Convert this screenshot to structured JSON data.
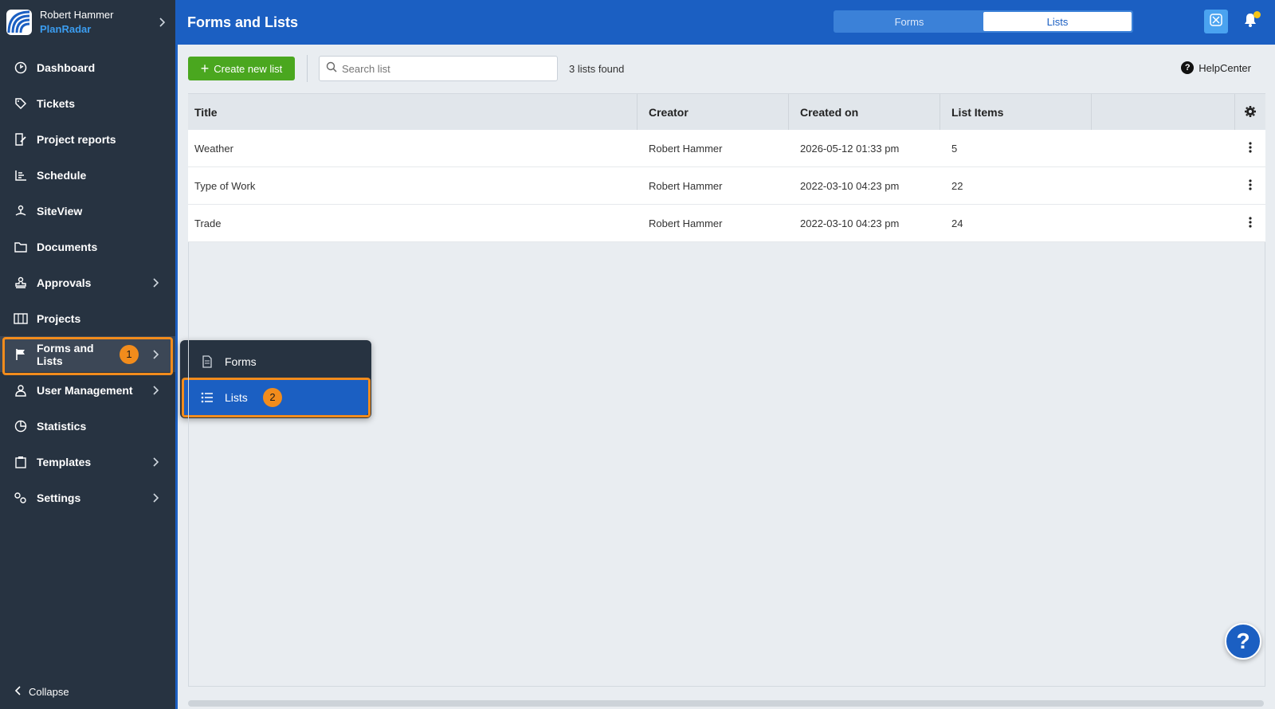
{
  "user": {
    "name": "Robert Hammer",
    "brand": "PlanRadar"
  },
  "sidebar": {
    "items": [
      {
        "label": "Dashboard",
        "icon": "dashboard-icon",
        "has_chevron": false
      },
      {
        "label": "Tickets",
        "icon": "tag-icon",
        "has_chevron": false
      },
      {
        "label": "Project reports",
        "icon": "report-icon",
        "has_chevron": false
      },
      {
        "label": "Schedule",
        "icon": "schedule-icon",
        "has_chevron": false
      },
      {
        "label": "SiteView",
        "icon": "siteview-icon",
        "has_chevron": false
      },
      {
        "label": "Documents",
        "icon": "folder-icon",
        "has_chevron": false
      },
      {
        "label": "Approvals",
        "icon": "stamp-icon",
        "has_chevron": true
      },
      {
        "label": "Projects",
        "icon": "projects-icon",
        "has_chevron": false
      },
      {
        "label": "Forms and Lists",
        "icon": "flag-icon",
        "has_chevron": true,
        "badge": "1"
      },
      {
        "label": "User Management",
        "icon": "user-icon",
        "has_chevron": true
      },
      {
        "label": "Statistics",
        "icon": "pie-chart-icon",
        "has_chevron": false
      },
      {
        "label": "Templates",
        "icon": "clipboard-icon",
        "has_chevron": true
      },
      {
        "label": "Settings",
        "icon": "gears-icon",
        "has_chevron": true
      }
    ],
    "collapse_label": "Collapse"
  },
  "flyout": {
    "items": [
      {
        "label": "Forms",
        "icon": "document-icon"
      },
      {
        "label": "Lists",
        "icon": "list-icon",
        "badge": "2"
      }
    ]
  },
  "header": {
    "title": "Forms and Lists",
    "segments": [
      "Forms",
      "Lists"
    ],
    "active_segment": "Lists"
  },
  "toolbar": {
    "create_label": "Create new list",
    "search_placeholder": "Search list",
    "count_text": "3 lists found",
    "help_label": "HelpCenter"
  },
  "table": {
    "columns": [
      "Title",
      "Creator",
      "Created on",
      "List Items"
    ],
    "rows": [
      {
        "title": "Weather",
        "creator": "Robert Hammer",
        "created_on": "2026-05-12 01:33 pm",
        "items": "5"
      },
      {
        "title": "Type of Work",
        "creator": "Robert Hammer",
        "created_on": "2022-03-10 04:23 pm",
        "items": "22"
      },
      {
        "title": "Trade",
        "creator": "Robert Hammer",
        "created_on": "2022-03-10 04:23 pm",
        "items": "24"
      }
    ]
  },
  "fab_label": "?",
  "colors": {
    "header": "#1b5fc2",
    "sidebar": "#273341",
    "accent_orange": "#f28c1c",
    "create_green": "#4aa71f"
  }
}
